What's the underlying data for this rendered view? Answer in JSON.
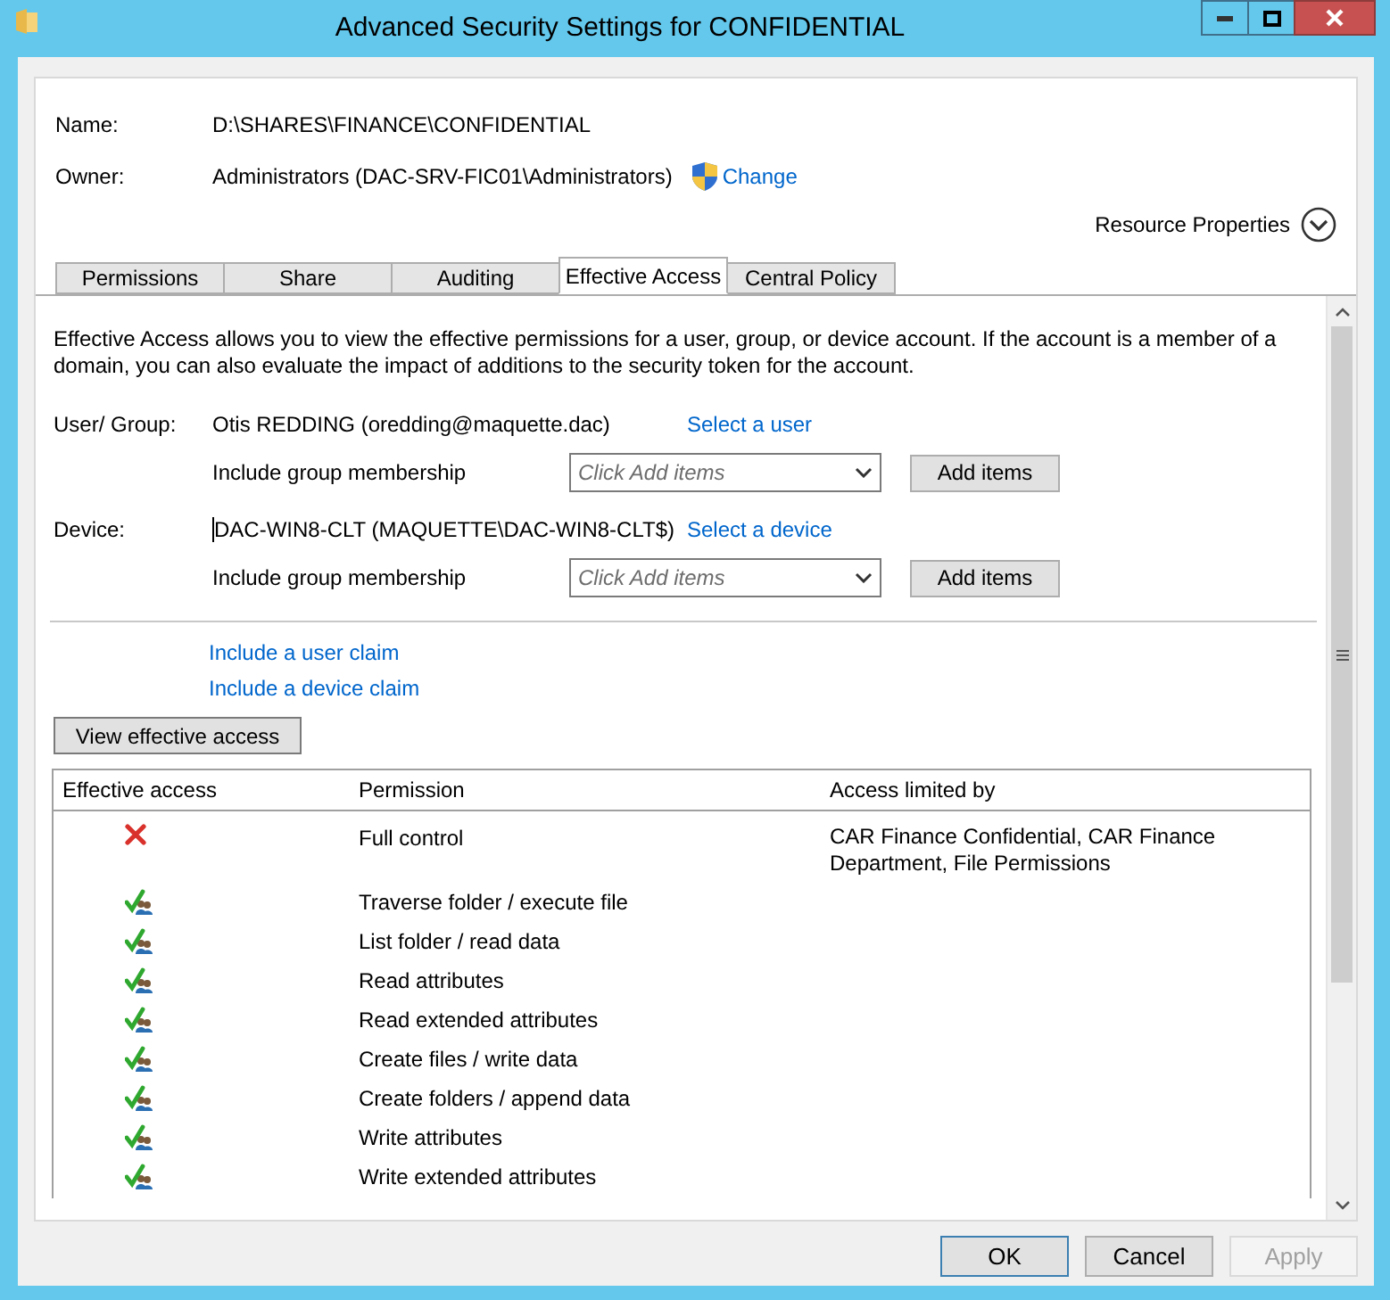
{
  "window": {
    "title": "Advanced Security Settings for CONFIDENTIAL"
  },
  "header": {
    "name_label": "Name:",
    "name_value": "D:\\SHARES\\FINANCE\\CONFIDENTIAL",
    "owner_label": "Owner:",
    "owner_value": "Administrators (DAC-SRV-FIC01\\Administrators)",
    "change_link": "Change",
    "resource_properties": "Resource Properties"
  },
  "tabs": [
    {
      "label": "Permissions",
      "selected": false
    },
    {
      "label": "Share",
      "selected": false
    },
    {
      "label": "Auditing",
      "selected": false
    },
    {
      "label": "Effective Access",
      "selected": true
    },
    {
      "label": "Central Policy",
      "selected": false
    }
  ],
  "description": "Effective Access allows you to view the effective permissions for a user, group, or device account. If the account is a member of a domain, you can also evaluate the impact of additions to the security token for the account.",
  "principals": [
    {
      "label": "User/ Group:",
      "value": "Otis REDDING (oredding@maquette.dac)",
      "caret": false,
      "link": "Select a user",
      "membership_label": "Include group membership",
      "placeholder": "Click Add items",
      "add_button": "Add items"
    },
    {
      "label": "Device:",
      "value": "DAC-WIN8-CLT (MAQUETTE\\DAC-WIN8-CLT$)",
      "caret": true,
      "link": "Select a device",
      "membership_label": "Include group membership",
      "placeholder": "Click Add items",
      "add_button": "Add items"
    }
  ],
  "claim_links": [
    "Include a user claim",
    "Include a device claim"
  ],
  "view_button": "View effective access",
  "table": {
    "columns": [
      "Effective access",
      "Permission",
      "Access limited by"
    ],
    "rows": [
      {
        "kind": "denied",
        "permission": "Full control",
        "limited_by": "CAR Finance Confidential, CAR Finance Department, File Permissions"
      },
      {
        "kind": "allowed",
        "permission": "Traverse folder / execute file"
      },
      {
        "kind": "allowed",
        "permission": "List folder / read data"
      },
      {
        "kind": "allowed",
        "permission": "Read attributes"
      },
      {
        "kind": "allowed",
        "permission": "Read extended attributes"
      },
      {
        "kind": "allowed",
        "permission": "Create files / write data"
      },
      {
        "kind": "allowed",
        "permission": "Create folders / append data"
      },
      {
        "kind": "allowed",
        "permission": "Write attributes"
      },
      {
        "kind": "allowed",
        "permission": "Write extended attributes"
      }
    ]
  },
  "buttons": [
    {
      "label": "OK",
      "default": true,
      "disabled": false
    },
    {
      "label": "Cancel",
      "default": false,
      "disabled": false
    },
    {
      "label": "Apply",
      "default": false,
      "disabled": true
    }
  ]
}
